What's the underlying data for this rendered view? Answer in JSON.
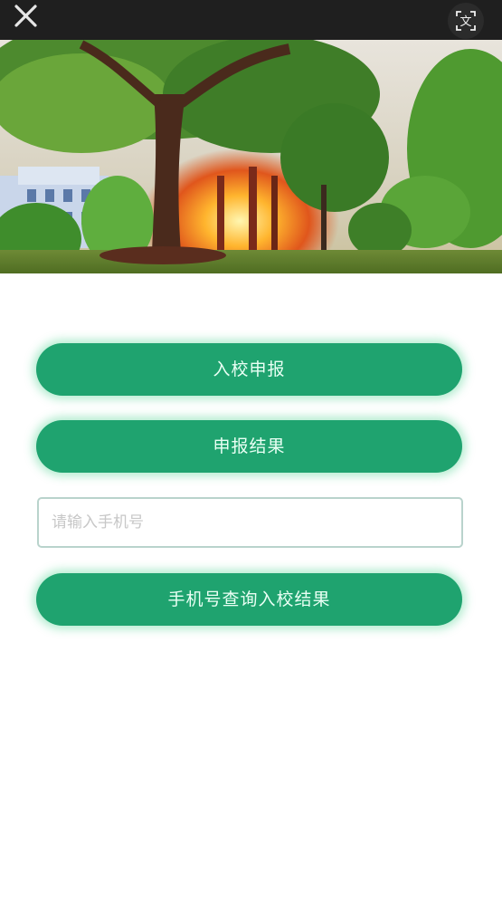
{
  "topbar": {
    "close_icon": "close-icon",
    "translate_icon": "translate-icon",
    "translate_glyph": "文"
  },
  "banner": {
    "description_icon": "campus-photo"
  },
  "actions": {
    "apply_label": "入校申报",
    "result_label": "申报结果",
    "query_label": "手机号查询入校结果"
  },
  "phone": {
    "placeholder": "请输入手机号",
    "value": ""
  },
  "colors": {
    "accent": "#1fa36f",
    "topbar": "#1f1f1f"
  }
}
